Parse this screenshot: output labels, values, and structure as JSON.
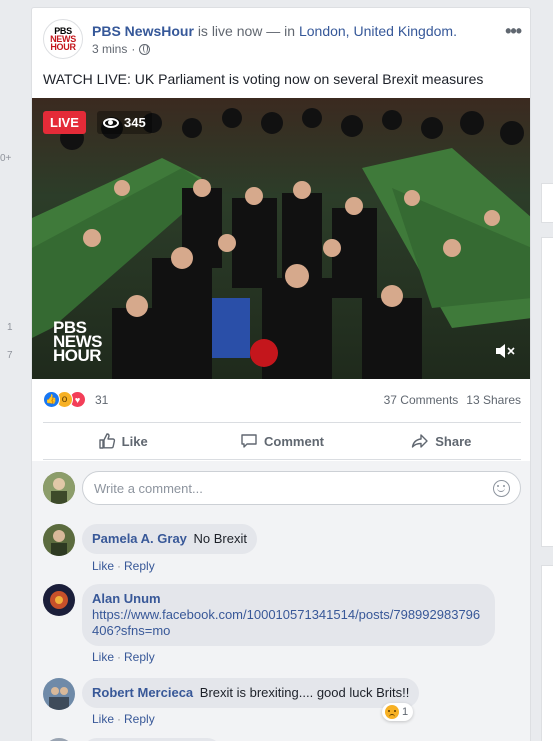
{
  "left_rail": {
    "numbers": [
      "0+",
      "1",
      "7"
    ]
  },
  "post": {
    "page_name": "PBS NewsHour",
    "live_text": "is live now — in",
    "location": "London, United Kingdom.",
    "time": "3 mins",
    "avatar_lines": [
      "PBS",
      "NEWS",
      "HOUR"
    ],
    "text": "WATCH LIVE: UK Parliament is voting now on several Brexit measures",
    "more_icon": "ellipsis-icon"
  },
  "video": {
    "live_label": "LIVE",
    "viewer_count": "345",
    "watermark": [
      "PBS",
      "NEWS",
      "HOUR"
    ],
    "mute_icon": "speaker-muted-icon"
  },
  "reactions": {
    "icons": [
      "like-icon",
      "wow-icon",
      "love-icon"
    ],
    "count": "31",
    "comments": "37 Comments",
    "shares": "13 Shares"
  },
  "actions": {
    "like": "Like",
    "comment": "Comment",
    "share": "Share"
  },
  "composer": {
    "placeholder": "Write a comment..."
  },
  "comments": [
    {
      "name": "Pamela A. Gray",
      "text": "No Brexit",
      "like": "Like",
      "reply": "Reply"
    },
    {
      "name": "Alan Unum",
      "text": "https://www.facebook.com/100010571341514/posts/798992983796406?sfns=mo",
      "like": "Like",
      "reply": "Reply"
    },
    {
      "name": "Robert Mercieca",
      "text": "Brexit is brexiting.... good luck Brits!!",
      "like": "Like",
      "reply": "Reply",
      "reaction_count": "1"
    }
  ],
  "colors": {
    "accent": "#365899",
    "live": "#e42b38",
    "background": "#e9ebee"
  }
}
